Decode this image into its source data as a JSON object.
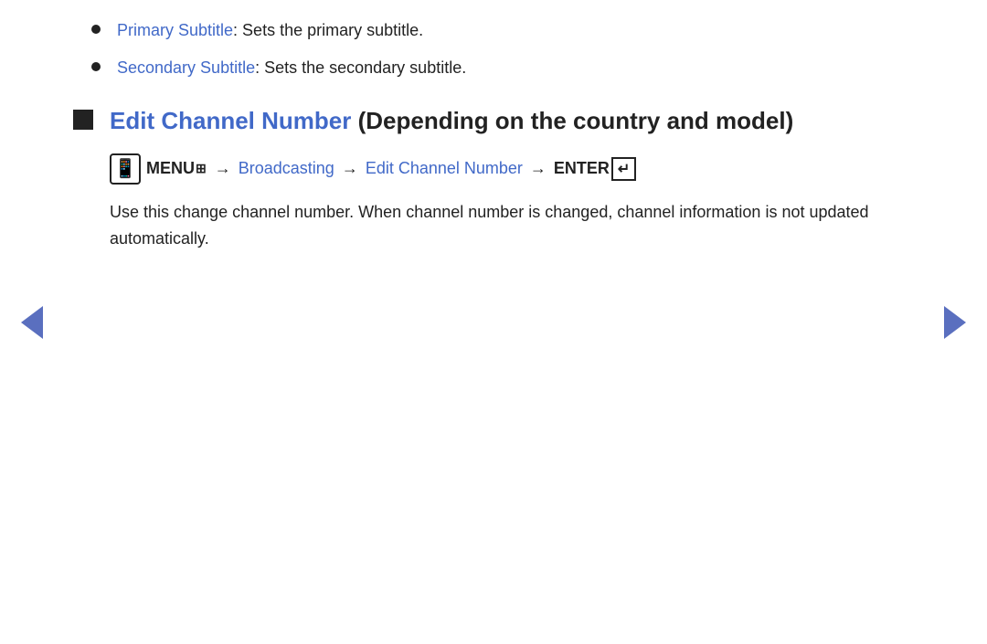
{
  "page": {
    "background": "#ffffff"
  },
  "bullets": [
    {
      "id": "primary-subtitle",
      "link_text": "Primary Subtitle",
      "description": ": Sets the primary subtitle."
    },
    {
      "id": "secondary-subtitle",
      "link_text": "Secondary Subtitle",
      "description": ": Sets the secondary subtitle."
    }
  ],
  "section": {
    "title_link": "Edit Channel Number",
    "title_suffix": " (Depending on the country and model)",
    "nav": {
      "menu_label": "MENU",
      "menu_icon_symbol": "⊞",
      "arrow": "→",
      "broadcasting": "Broadcasting",
      "edit_channel_number": "Edit Channel Number",
      "enter_label": "ENTER"
    },
    "description": "Use this change channel number. When channel number is changed, channel information is not updated automatically."
  },
  "navigation": {
    "prev_label": "◀",
    "next_label": "▶"
  }
}
